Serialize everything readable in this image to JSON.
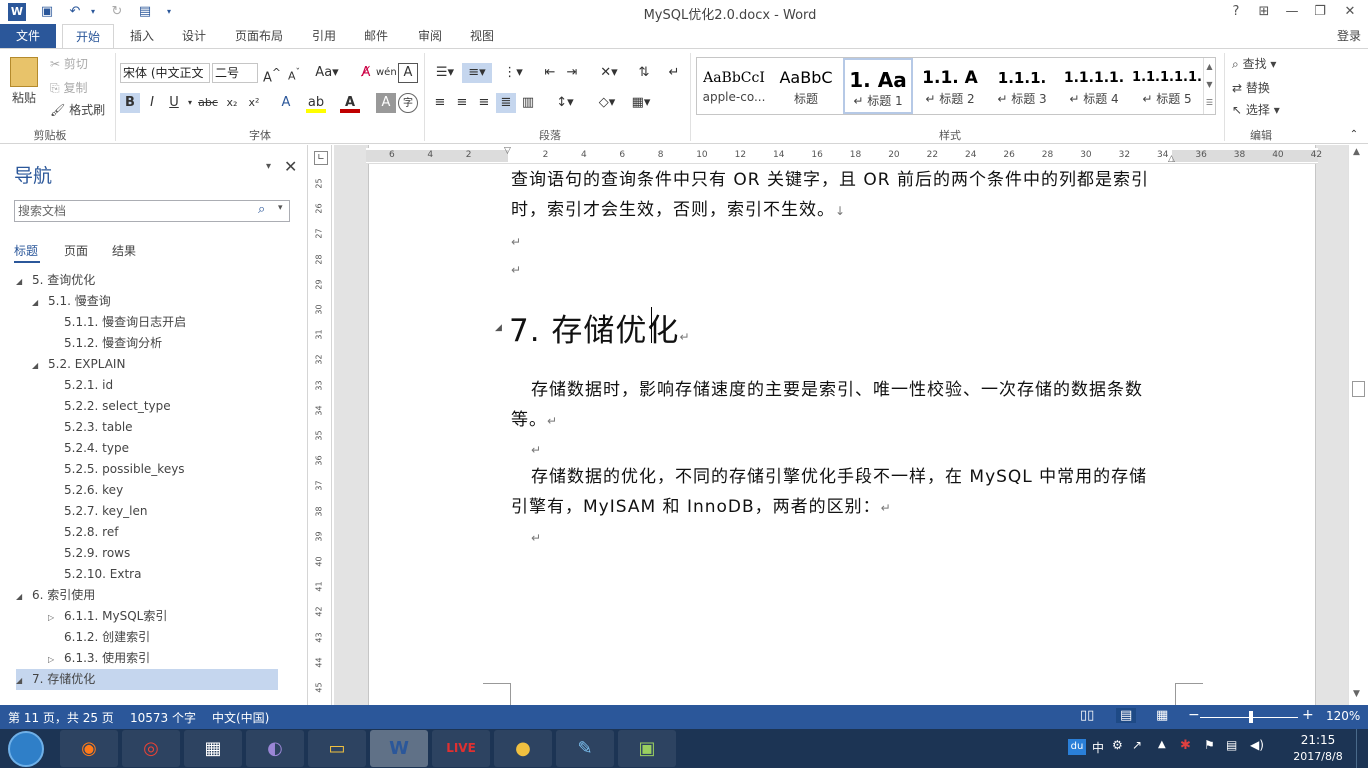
{
  "window": {
    "title": "MySQL优化2.0.docx - Word"
  },
  "titlebar": {
    "help": "?",
    "minimize": "—",
    "restore": "❐",
    "close": "✕"
  },
  "tabs": [
    "文件",
    "开始",
    "插入",
    "设计",
    "页面布局",
    "引用",
    "邮件",
    "审阅",
    "视图"
  ],
  "account": "登录",
  "clipboard": {
    "paste": "粘贴",
    "cut": "剪切",
    "copy": "复制",
    "format_painter": "格式刷",
    "group": "剪贴板"
  },
  "font": {
    "family": "宋体 (中文正文",
    "size": "二号",
    "group": "字体"
  },
  "paragraph": {
    "group": "段落"
  },
  "styles": {
    "group": "样式",
    "items": [
      {
        "preview": "AaBbCcI",
        "name": "apple-co..."
      },
      {
        "preview": "AaBbC",
        "name": "标题"
      },
      {
        "preview": "1.  Aa",
        "name": "↵ 标题 1"
      },
      {
        "preview": "1.1.  A",
        "name": "↵ 标题 2"
      },
      {
        "preview": "1.1.1.",
        "name": "↵ 标题 3"
      },
      {
        "preview": "1.1.1.1.",
        "name": "↵ 标题 4"
      },
      {
        "preview": "1.1.1.1.1.",
        "name": "↵ 标题 5"
      }
    ]
  },
  "editing": {
    "find": "查找",
    "replace": "替换",
    "select": "选择",
    "group": "编辑"
  },
  "nav": {
    "title": "导航",
    "search_placeholder": "搜索文档",
    "tabs": [
      "标题",
      "页面",
      "结果"
    ],
    "items": [
      {
        "label": "5. 查询优化",
        "level": 0,
        "toggle": "◢"
      },
      {
        "label": "5.1. 慢查询",
        "level": 1,
        "toggle": "◢"
      },
      {
        "label": "5.1.1. 慢查询日志开启",
        "level": 2,
        "toggle": ""
      },
      {
        "label": "5.1.2. 慢查询分析",
        "level": 2,
        "toggle": ""
      },
      {
        "label": "5.2. EXPLAIN",
        "level": 1,
        "toggle": "◢"
      },
      {
        "label": "5.2.1. id",
        "level": 2,
        "toggle": ""
      },
      {
        "label": "5.2.2. select_type",
        "level": 2,
        "toggle": ""
      },
      {
        "label": "5.2.3. table",
        "level": 2,
        "toggle": ""
      },
      {
        "label": "5.2.4. type",
        "level": 2,
        "toggle": ""
      },
      {
        "label": "5.2.5. possible_keys",
        "level": 2,
        "toggle": ""
      },
      {
        "label": "5.2.6. key",
        "level": 2,
        "toggle": ""
      },
      {
        "label": "5.2.7. key_len",
        "level": 2,
        "toggle": ""
      },
      {
        "label": "5.2.8. ref",
        "level": 2,
        "toggle": ""
      },
      {
        "label": "5.2.9. rows",
        "level": 2,
        "toggle": ""
      },
      {
        "label": "5.2.10. Extra",
        "level": 2,
        "toggle": ""
      },
      {
        "label": "6. 索引使用",
        "level": 0,
        "toggle": "◢"
      },
      {
        "label": "6.1.1. MySQL索引",
        "level": 2,
        "toggle": "▷"
      },
      {
        "label": "6.1.2. 创建索引",
        "level": 2,
        "toggle": ""
      },
      {
        "label": "6.1.3. 使用索引",
        "level": 2,
        "toggle": "▷"
      },
      {
        "label": "7. 存储优化",
        "level": 0,
        "toggle": "◢",
        "selected": true
      }
    ]
  },
  "hruler": [
    "6",
    "4",
    "2",
    "",
    "2",
    "4",
    "6",
    "8",
    "10",
    "12",
    "14",
    "16",
    "18",
    "20",
    "22",
    "24",
    "26",
    "28",
    "30",
    "32",
    "34",
    "36",
    "38",
    "40",
    "42"
  ],
  "vruler": [
    "25",
    "26",
    "27",
    "28",
    "29",
    "30",
    "31",
    "32",
    "33",
    "34",
    "35",
    "36",
    "37",
    "38",
    "39",
    "40",
    "41",
    "42",
    "43",
    "44",
    "45"
  ],
  "document": {
    "p1_line1": "查询语句的查询条件中只有 OR 关键字，且 OR 前后的两个条件中的列都是索引",
    "p1_line2": "时，索引才会生效，否则，索引不生效。",
    "heading": "7. 存储优化",
    "p2_line1": "存储数据时，影响存储速度的主要是索引、唯一性校验、一次存储的数据条数",
    "p2_line2": "等。",
    "p3_line1": "存储数据的优化，不同的存储引擎优化手段不一样，在 MySQL 中常用的存储",
    "p3_line2": "引擎有，MyISAM 和 InnoDB，两者的区别：",
    "para_mark": "↵",
    "line_mark": "↓"
  },
  "status": {
    "page": "第 11 页，共 25 页",
    "words": "10573 个字",
    "language": "中文(中国)",
    "zoom": "120%",
    "zoom_level_pct": 120
  },
  "taskbar": {
    "time": "21:15",
    "date": "2017/8/8",
    "ime": "中"
  }
}
